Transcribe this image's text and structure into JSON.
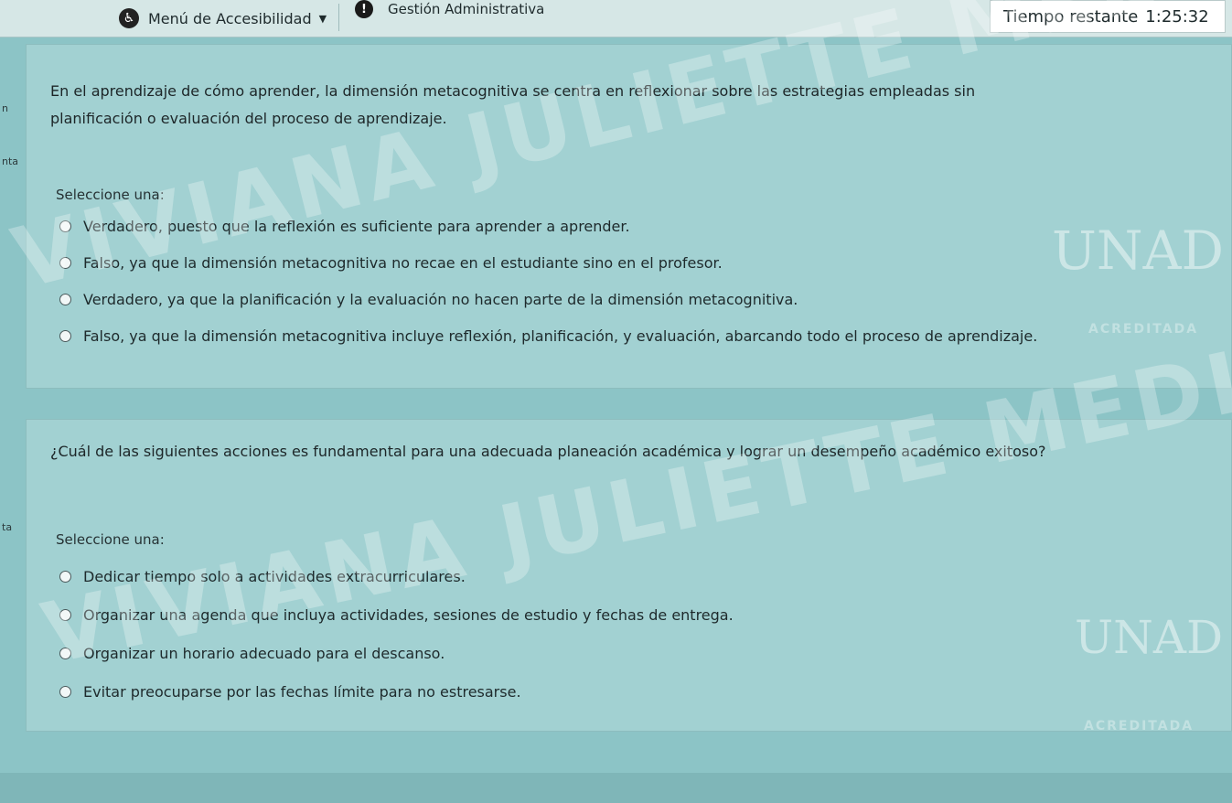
{
  "topbar": {
    "accessibility_menu": "Menú de Accesibilidad",
    "admin_link": "Gestión Administrativa",
    "timer_label": "Tiempo restante",
    "timer_value": "1:25:32"
  },
  "questions": [
    {
      "text": "En el aprendizaje de cómo aprender, la dimensión metacognitiva se centra en reflexionar sobre las estrategias empleadas sin planificación o evaluación del proceso de aprendizaje.",
      "select_label": "Seleccione una:",
      "options": [
        "Verdadero, puesto que la reflexión es suficiente para aprender a aprender.",
        "Falso, ya que la dimensión metacognitiva no recae en el estudiante sino en el profesor.",
        "Verdadero, ya que la planificación y la evaluación no hacen parte de la dimensión metacognitiva.",
        "Falso, ya que la dimensión metacognitiva incluye reflexión, planificación, y evaluación, abarcando todo el proceso de aprendizaje."
      ]
    },
    {
      "text": "¿Cuál de las siguientes acciones es fundamental para una adecuada planeación académica y lograr un desempeño académico exitoso?",
      "select_label": "Seleccione una:",
      "options": [
        "Dedicar tiempo solo a actividades extracurriculares.",
        "Organizar una agenda que incluya actividades, sesiones de estudio y fechas de entrega.",
        "Organizar un horario adecuado para el descanso.",
        "Evitar preocuparse por las fechas límite para no estresarse."
      ]
    }
  ],
  "watermark": {
    "text": "VIVIANA JULIETTE MEDINA VEGA",
    "logo": "UNAD",
    "accredited": "ACREDITADA"
  },
  "side_fragments": [
    "n",
    "nta",
    "ta"
  ]
}
